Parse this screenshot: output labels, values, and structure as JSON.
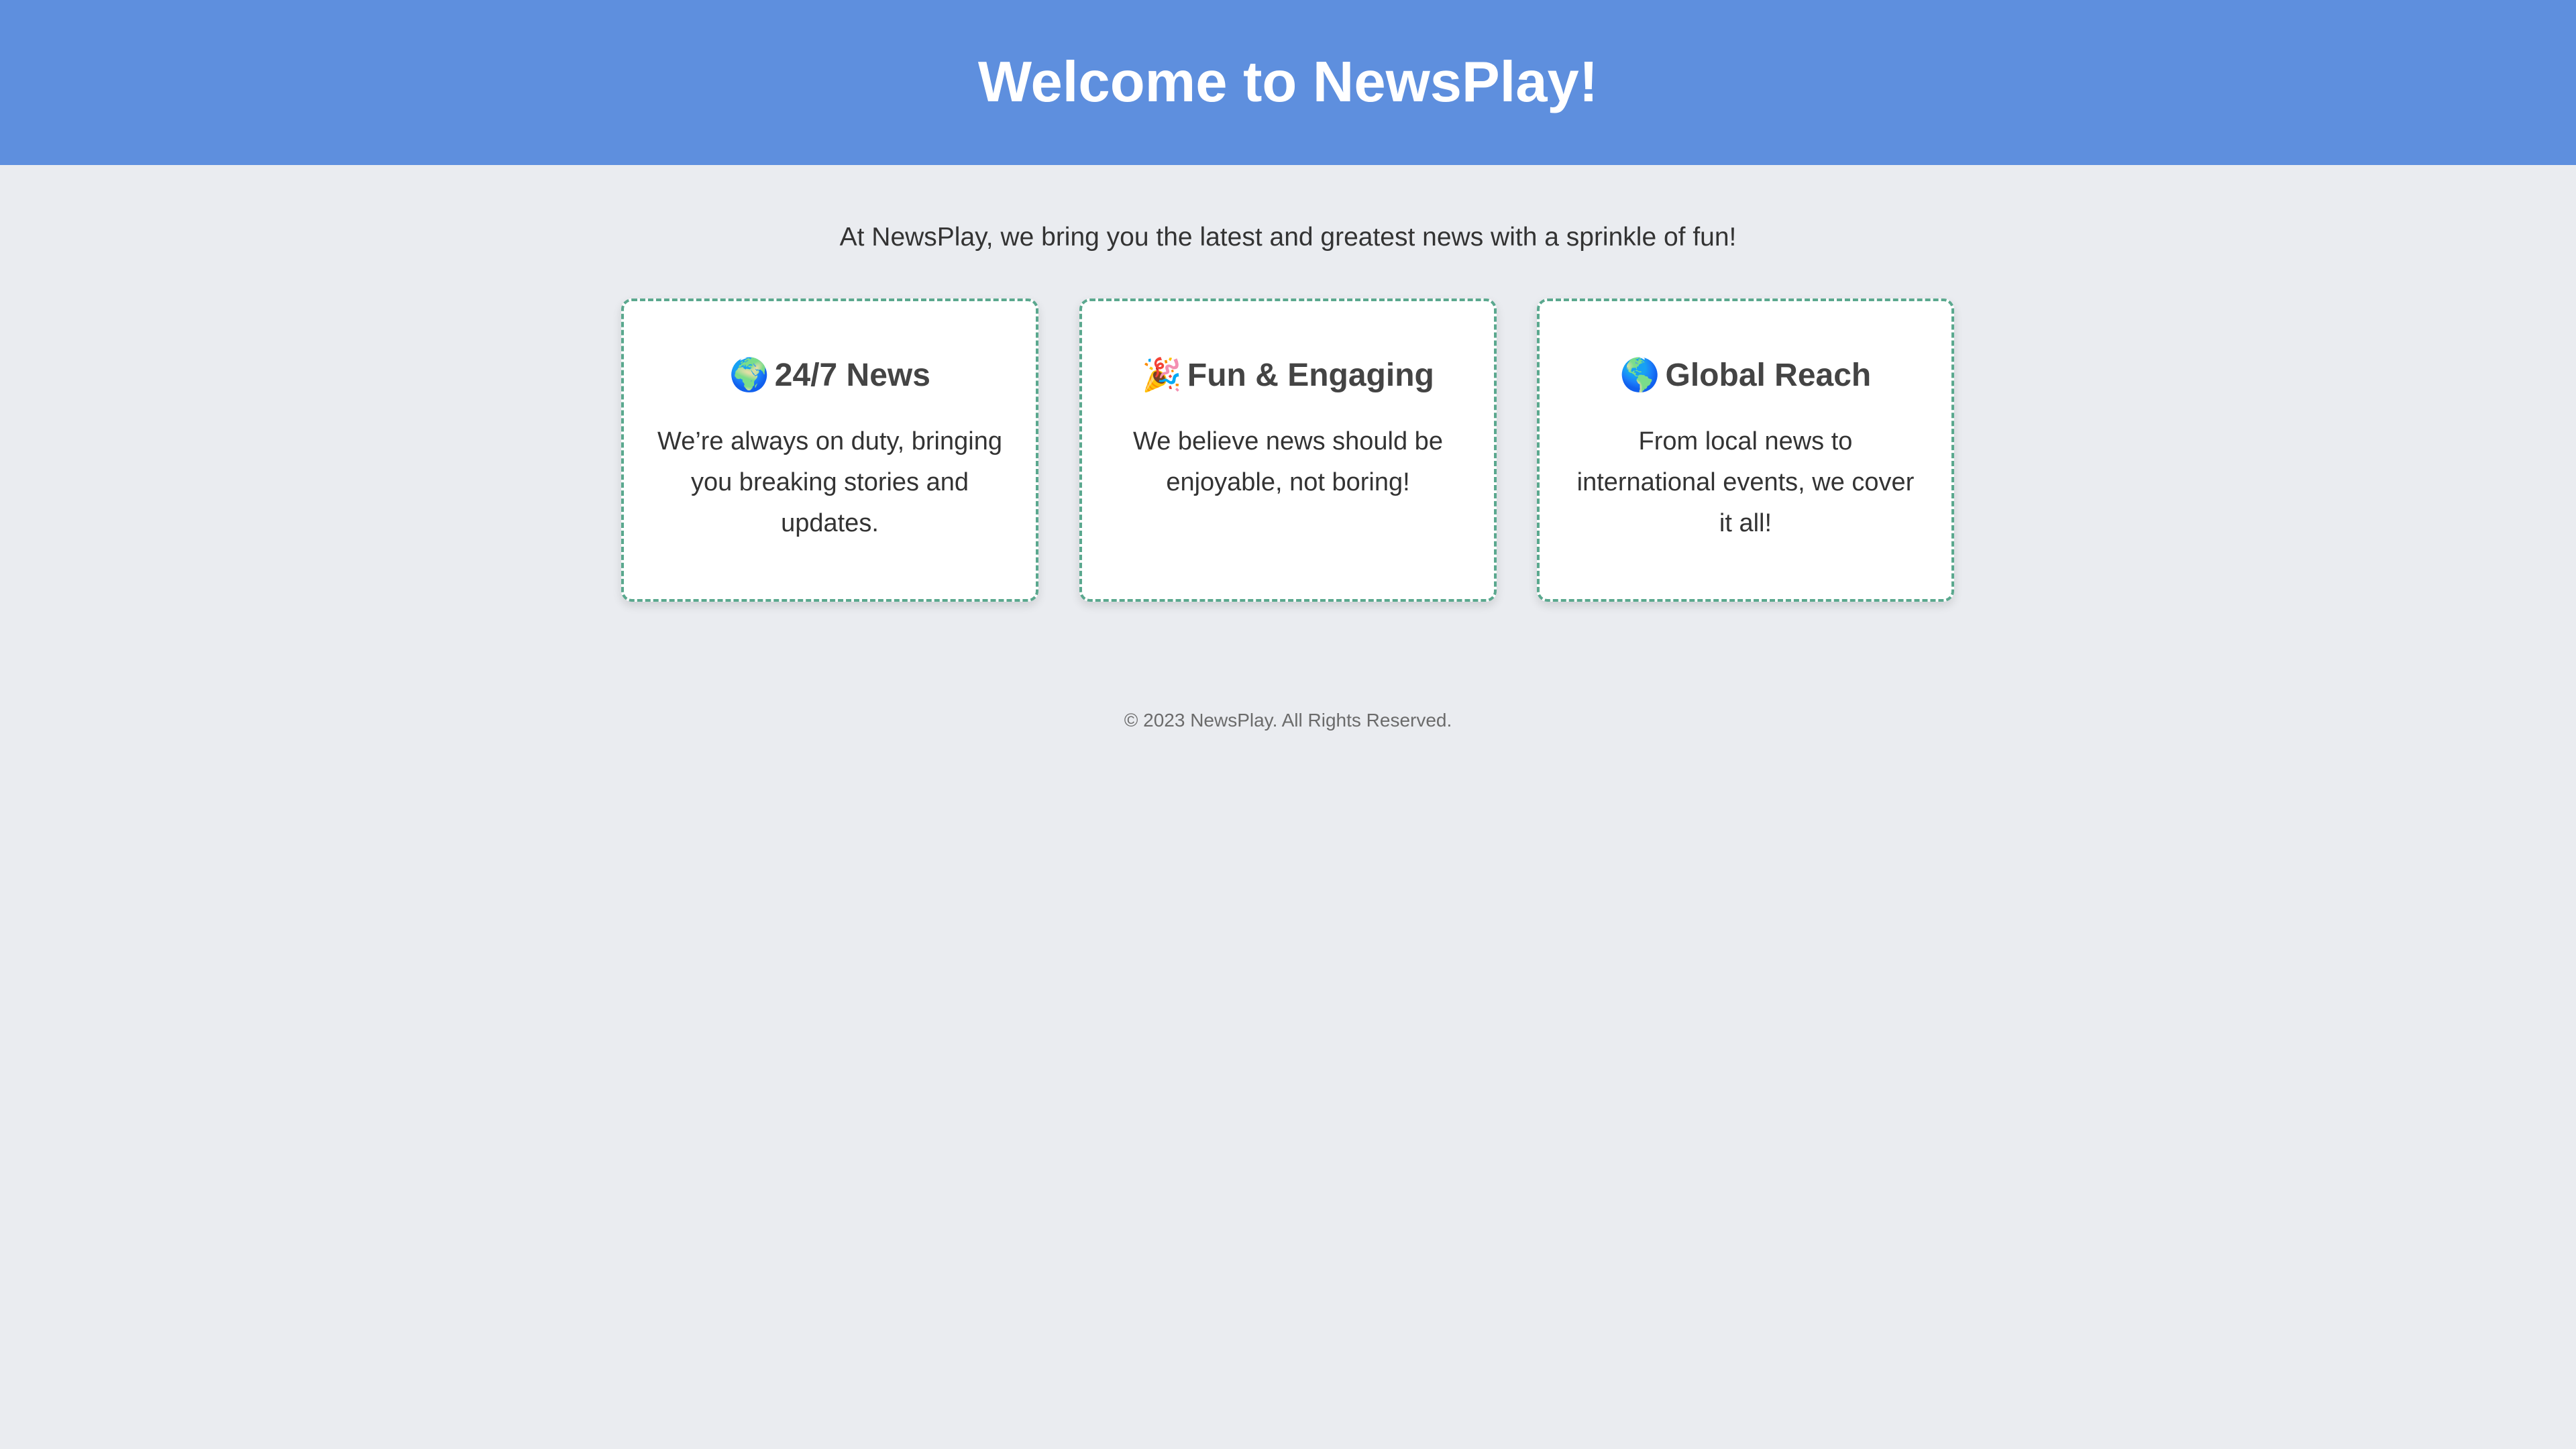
{
  "header": {
    "title": "Welcome to NewsPlay!"
  },
  "intro": {
    "text": "At NewsPlay, we bring you the latest and greatest news with a sprinkle of fun!"
  },
  "cards": [
    {
      "emoji": "🌍",
      "title": "24/7 News",
      "body": "We’re always on duty, bringing you breaking stories and updates."
    },
    {
      "emoji": "🎉",
      "title": "Fun & Engaging",
      "body": "We believe news should be enjoyable, not boring!"
    },
    {
      "emoji": "🌎",
      "title": "Global Reach",
      "body": "From local news to international events, we cover it all!"
    }
  ],
  "footer": {
    "text": "© 2023 NewsPlay. All Rights Reserved."
  },
  "colors": {
    "header_bg": "#5e8fde",
    "page_bg": "#eaecf0",
    "card_border": "#5aa88e"
  }
}
